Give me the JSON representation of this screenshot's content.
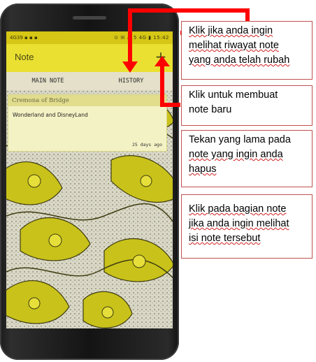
{
  "status_bar": {
    "left": "4G39 ▪ ▪ ▪",
    "right": "⊙ ✉ ⚠ 5 4G ▮ 15:42"
  },
  "app": {
    "title": "Note",
    "add_label": "+"
  },
  "tabs": [
    {
      "label": "MAIN NOTE"
    },
    {
      "label": "HISTORY"
    }
  ],
  "note": {
    "title": "Cremona of Bridge",
    "body": "Wonderland and DisneyLand",
    "time": "25 days ago"
  },
  "callouts": [
    {
      "text_1": "Klik jika anda ingin",
      "text_2": "melihat riwayat note",
      "text_3": "yang anda telah rubah"
    },
    {
      "text_1": "Klik untuk membuat",
      "text_2": "note baru"
    },
    {
      "text_1": "Tekan yang lama pada",
      "text_2": "note yang ingin anda",
      "text_3": "hapus"
    },
    {
      "text_1": "Klik pada bagian note",
      "text_2": "jika anda ingin melihat",
      "text_3": "isi note tersebut"
    }
  ],
  "colors": {
    "accent": "#e9e032",
    "status_bar": "#d6c615",
    "callout_border": "#c0504d",
    "arrow": "#ff0000"
  }
}
